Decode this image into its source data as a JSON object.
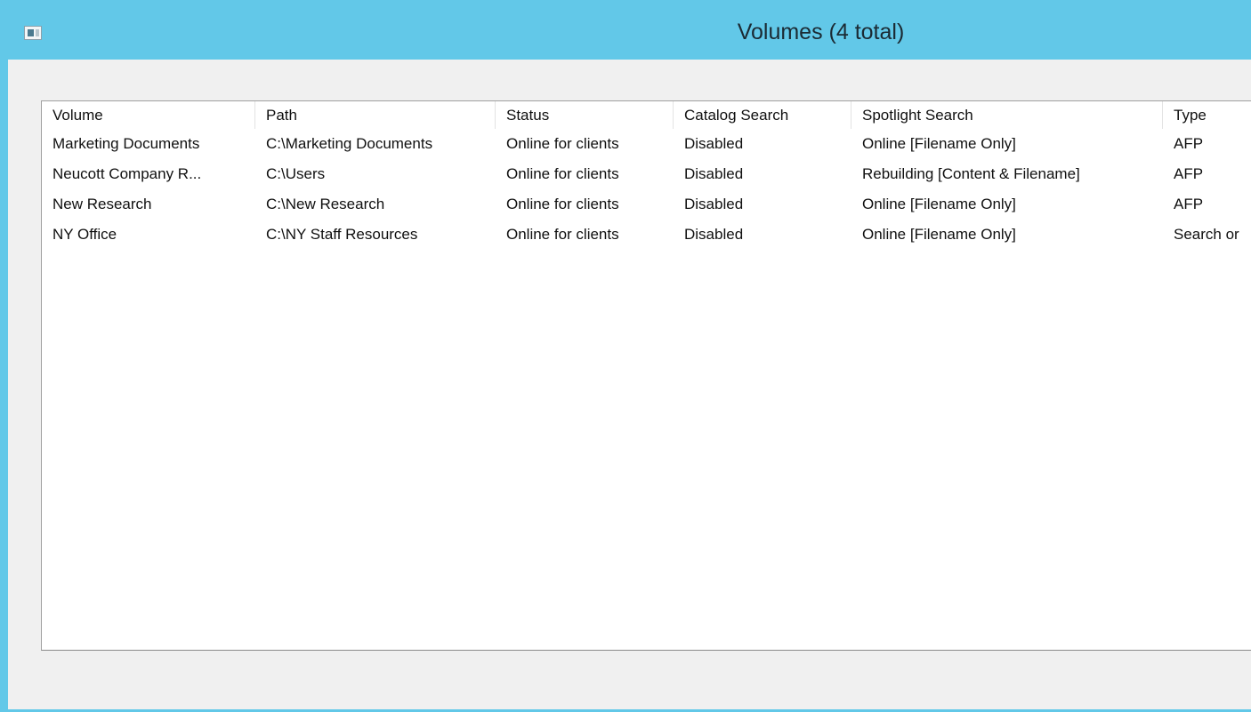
{
  "window": {
    "title": "Volumes (4 total)",
    "icon": "app-window-icon"
  },
  "table": {
    "columns": [
      "Volume",
      "Path",
      "Status",
      "Catalog Search",
      "Spotlight Search",
      "Type"
    ],
    "rows": [
      [
        "Marketing Documents",
        "C:\\Marketing Documents",
        "Online for clients",
        "Disabled",
        "Online [Filename Only]",
        "AFP"
      ],
      [
        "Neucott Company R...",
        "C:\\Users",
        "Online for clients",
        "Disabled",
        "Rebuilding [Content & Filename]",
        "AFP"
      ],
      [
        "New Research",
        "C:\\New Research",
        "Online for clients",
        "Disabled",
        "Online [Filename Only]",
        "AFP"
      ],
      [
        "NY Office",
        "C:\\NY Staff Resources",
        "Online for clients",
        "Disabled",
        "Online [Filename Only]",
        "Search or"
      ]
    ]
  },
  "colors": {
    "titlebar": "#62c8e8",
    "client_bg": "#f0f0f0",
    "list_bg": "#ffffff"
  }
}
